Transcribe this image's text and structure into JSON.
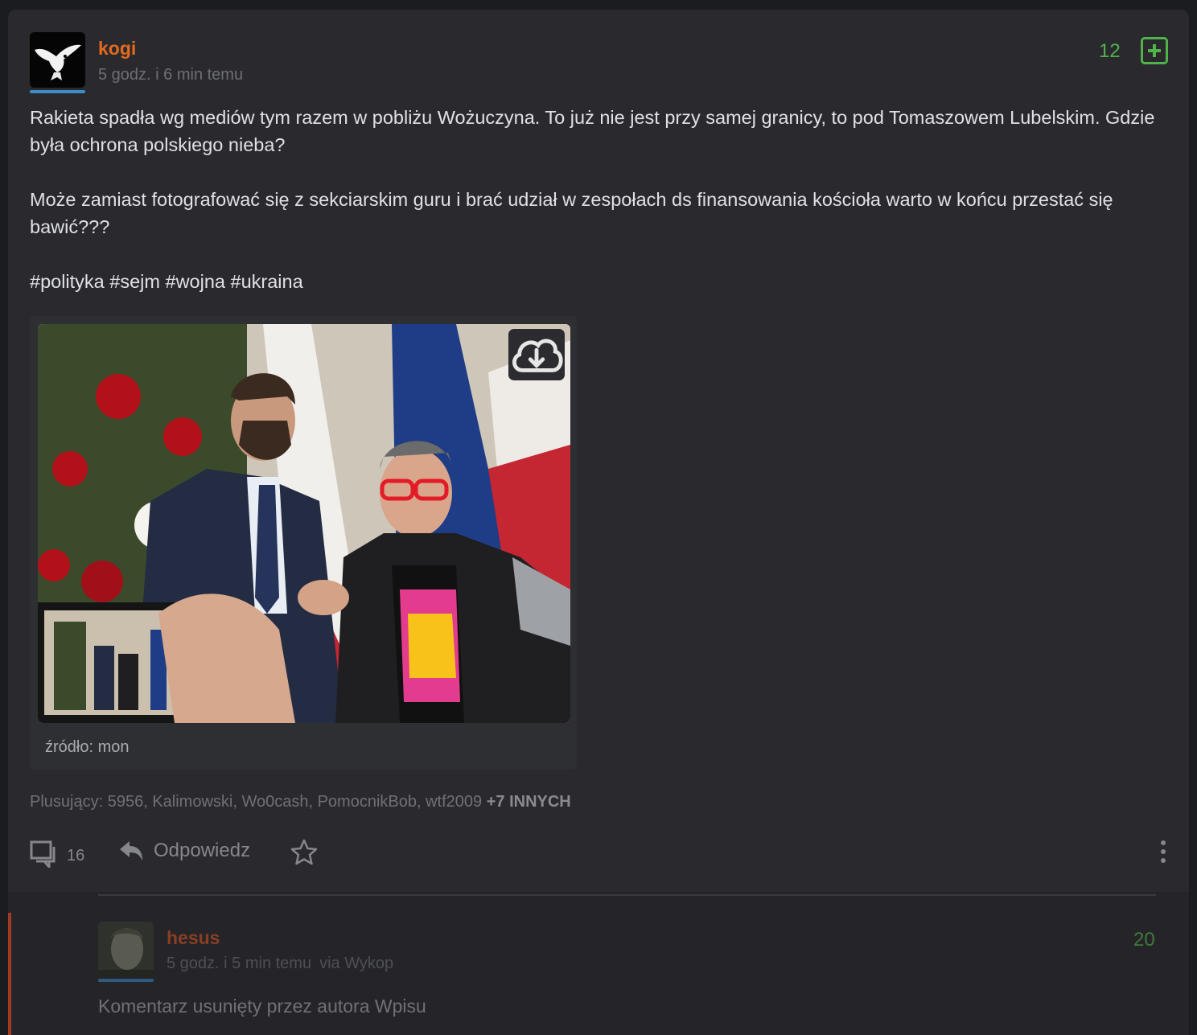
{
  "post": {
    "author": "kogi",
    "timestamp": "5 godz. i 6 min temu",
    "votes": "12",
    "paragraphs": [
      "Rakieta spadła wg mediów tym razem w pobliżu Wożuczyna. To już nie jest przy samej granicy, to pod Tomaszowem Lubelskim. Gdzie była ochrona polskiego nieba?",
      "Może zamiast fotografować się z sekciarskim guru i brać udział w zespołach ds finansowania kościoła warto w końcu przestać się bawić???"
    ],
    "tags": [
      "#polityka",
      "#sejm",
      "#wojna",
      "#ukraina"
    ],
    "image_source": "źródło: mon",
    "voters_text": "Plusujący: 5956, Kalimowski, Wo0cash, PomocnikBob, wtf2009",
    "voters_more": "+7 INNYCH",
    "comment_count": "16",
    "reply_label": "Odpowiedz",
    "colors": {
      "author": "#e36a1f",
      "vote": "#4fb34a"
    }
  },
  "comment": {
    "author": "hesus",
    "timestamp": "5 godz. i 5 min temu",
    "via": "via Wykop",
    "votes": "20",
    "text": "Komentarz usunięty przez autora Wpisu"
  },
  "icons": [
    "plus-icon",
    "download-cloud-icon",
    "comments-icon",
    "reply-icon",
    "star-icon",
    "more-dots-icon"
  ]
}
